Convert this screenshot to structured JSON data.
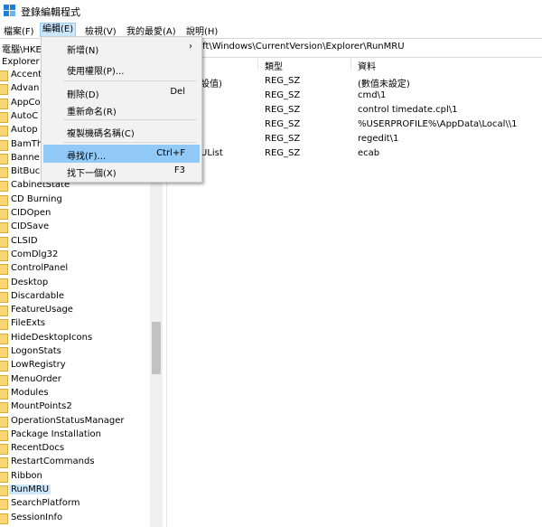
{
  "window": {
    "title": "登錄編輯程式"
  },
  "menubar": [
    {
      "label": "檔案(F)"
    },
    {
      "label": "編輯(E)"
    },
    {
      "label": "檢視(V)"
    },
    {
      "label": "我的最愛(A)"
    },
    {
      "label": "說明(H)"
    }
  ],
  "address": {
    "left": "電腦\\HKE",
    "right": "oft\\Windows\\CurrentVersion\\Explorer\\RunMRU"
  },
  "tree": {
    "root": "Explorer",
    "items": [
      "Accent",
      "Advan",
      "AppCo",
      "AutoC",
      "Autop",
      "BamTh",
      "Banne",
      "BitBuc",
      "CabinetState",
      "CD Burning",
      "CIDOpen",
      "CIDSave",
      "CLSID",
      "ComDlg32",
      "ControlPanel",
      "Desktop",
      "Discardable",
      "FeatureUsage",
      "FileExts",
      "HideDesktopIcons",
      "LogonStats",
      "LowRegistry",
      "MenuOrder",
      "Modules",
      "MountPoints2",
      "OperationStatusManager",
      "Package Installation",
      "RecentDocs",
      "RestartCommands",
      "Ribbon",
      "RunMRU",
      "SearchPlatform",
      "SessionInfo"
    ],
    "selected": "RunMRU"
  },
  "columns": {
    "name": "",
    "type": "類型",
    "data": "資料"
  },
  "values": [
    {
      "name": "設值)",
      "type": "REG_SZ",
      "data": "(數值未設定)"
    },
    {
      "name": "",
      "type": "REG_SZ",
      "data": "cmd\\1"
    },
    {
      "name": "",
      "type": "REG_SZ",
      "data": "control timedate.cpl\\1"
    },
    {
      "name": "",
      "type": "REG_SZ",
      "data": "%USERPROFILE%\\AppData\\Local\\\\1"
    },
    {
      "name": "",
      "type": "REG_SZ",
      "data": "regedit\\1"
    },
    {
      "name": "UList",
      "type": "REG_SZ",
      "data": "ecab"
    }
  ],
  "edit_menu": {
    "items": [
      {
        "label": "新增(N)",
        "shortcut": "",
        "submenu": true
      },
      {
        "label": "使用權限(P)...",
        "shortcut": ""
      },
      {
        "label": "刪除(D)",
        "shortcut": "Del"
      },
      {
        "label": "重新命名(R)",
        "shortcut": ""
      },
      {
        "label": "複製機碼名稱(C)",
        "shortcut": ""
      },
      {
        "label": "尋找(F)...",
        "shortcut": "Ctrl+F",
        "highlighted": true
      },
      {
        "label": "找下一個(X)",
        "shortcut": "F3"
      }
    ]
  },
  "colors": {
    "highlight": "#91c9f7",
    "selection": "#cce8ff",
    "folder": "#f7d674"
  }
}
